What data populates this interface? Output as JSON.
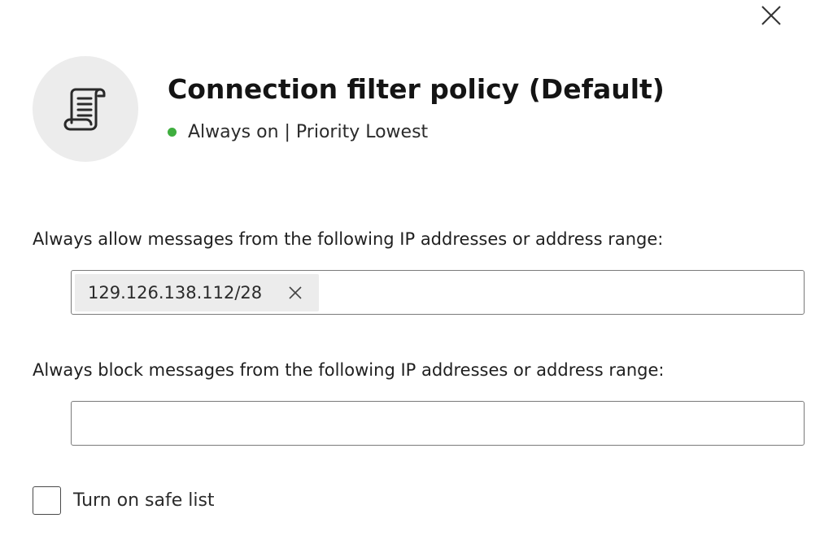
{
  "dialog": {
    "close_icon": "close-icon",
    "header": {
      "icon": "scroll-document-icon",
      "title": "Connection filter policy (Default)",
      "status_text": "Always on | Priority Lowest",
      "status_color": "#3fae3f"
    },
    "allow_section": {
      "label": "Always allow messages from the following IP addresses or address range:",
      "entries": [
        "129.126.138.112/28"
      ],
      "remove_icon": "close-icon"
    },
    "block_section": {
      "label": "Always block messages from the following IP addresses or address range:",
      "entries": []
    },
    "safe_list": {
      "label": "Turn on safe list",
      "checked": false
    }
  }
}
